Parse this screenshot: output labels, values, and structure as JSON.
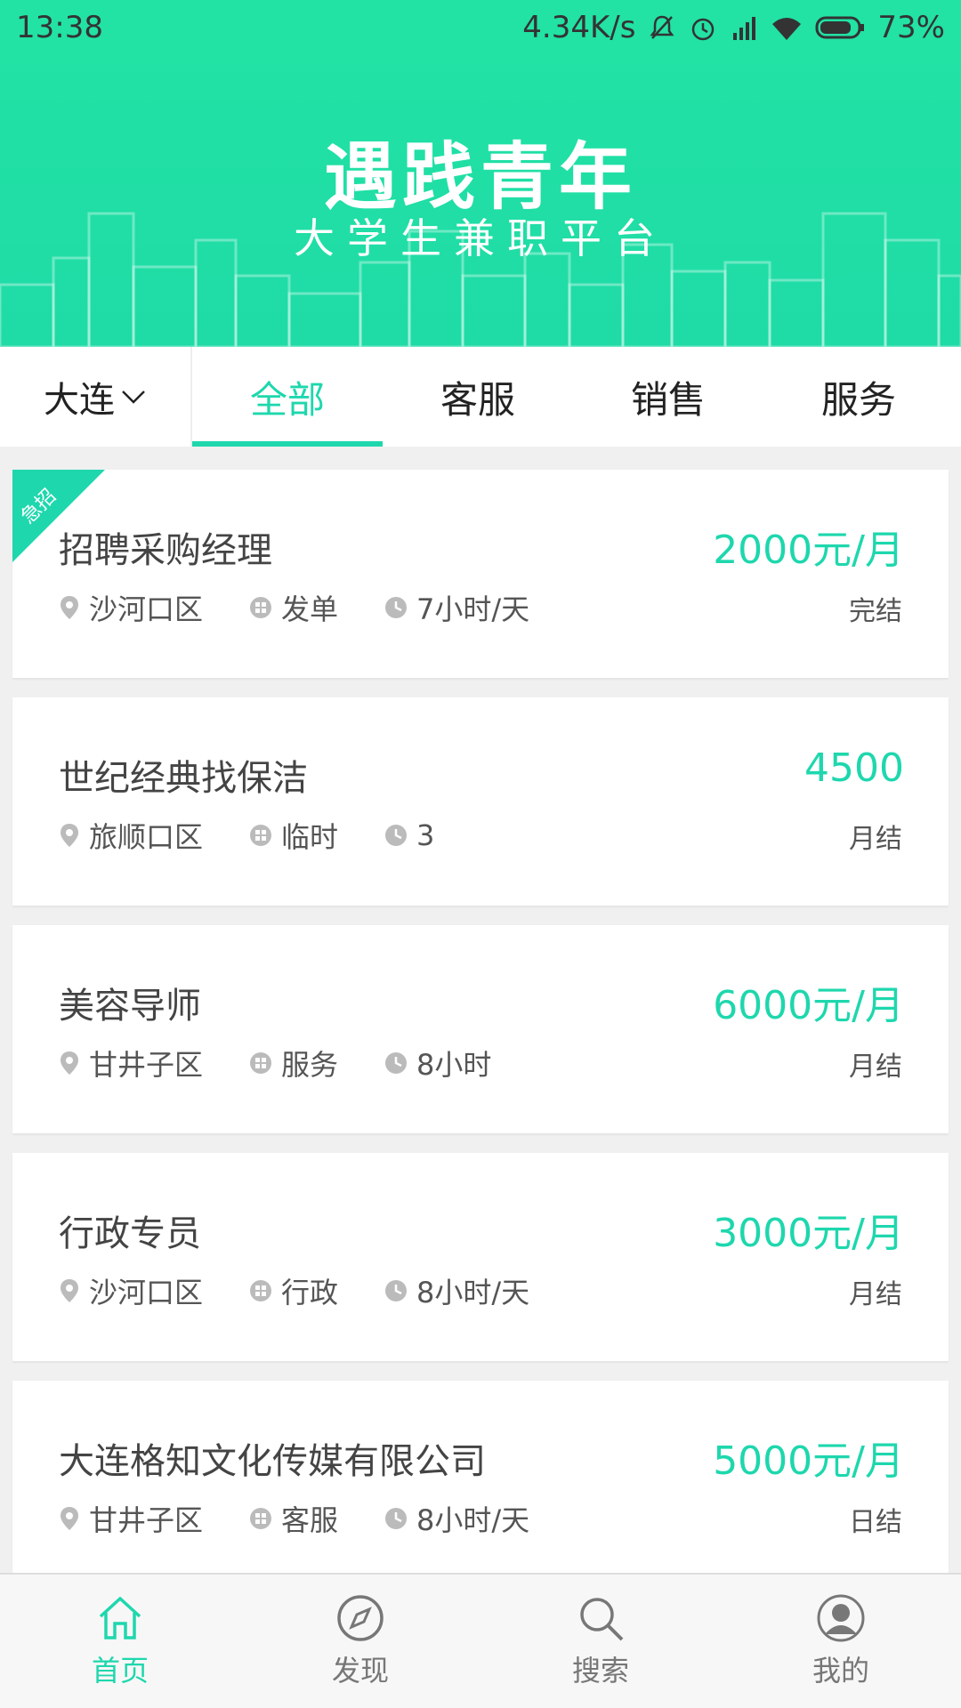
{
  "status": {
    "time": "13:38",
    "speed": "4.34K/s",
    "battery": "73%"
  },
  "banner": {
    "title": "遇践青年",
    "subtitle": "大学生兼职平台"
  },
  "city": "大连",
  "tabs": [
    "全部",
    "客服",
    "销售",
    "服务"
  ],
  "active_tab": "全部",
  "urgent_label": "急招",
  "jobs": [
    {
      "title": "招聘采购经理",
      "salary": "2000元/月",
      "district": "沙河口区",
      "category": "发单",
      "hours": "7小时/天",
      "settle": "完结"
    },
    {
      "title": "世纪经典找保洁",
      "salary": "4500",
      "district": "旅顺口区",
      "category": "临时",
      "hours": "3",
      "settle": "月结"
    },
    {
      "title": "美容导师",
      "salary": "6000元/月",
      "district": "甘井子区",
      "category": "服务",
      "hours": "8小时",
      "settle": "月结"
    },
    {
      "title": "行政专员",
      "salary": "3000元/月",
      "district": "沙河口区",
      "category": "行政",
      "hours": "8小时/天",
      "settle": "月结"
    },
    {
      "title": "大连格知文化传媒有限公司",
      "salary": "5000元/月",
      "district": "甘井子区",
      "category": "客服",
      "hours": "8小时/天",
      "settle": "日结"
    }
  ],
  "nav": [
    {
      "label": "首页",
      "icon": "home-icon"
    },
    {
      "label": "发现",
      "icon": "compass-icon"
    },
    {
      "label": "搜索",
      "icon": "search-icon"
    },
    {
      "label": "我的",
      "icon": "profile-icon"
    }
  ],
  "colors": {
    "accent": "#1ed7ad",
    "banner": "#22e3a4"
  }
}
